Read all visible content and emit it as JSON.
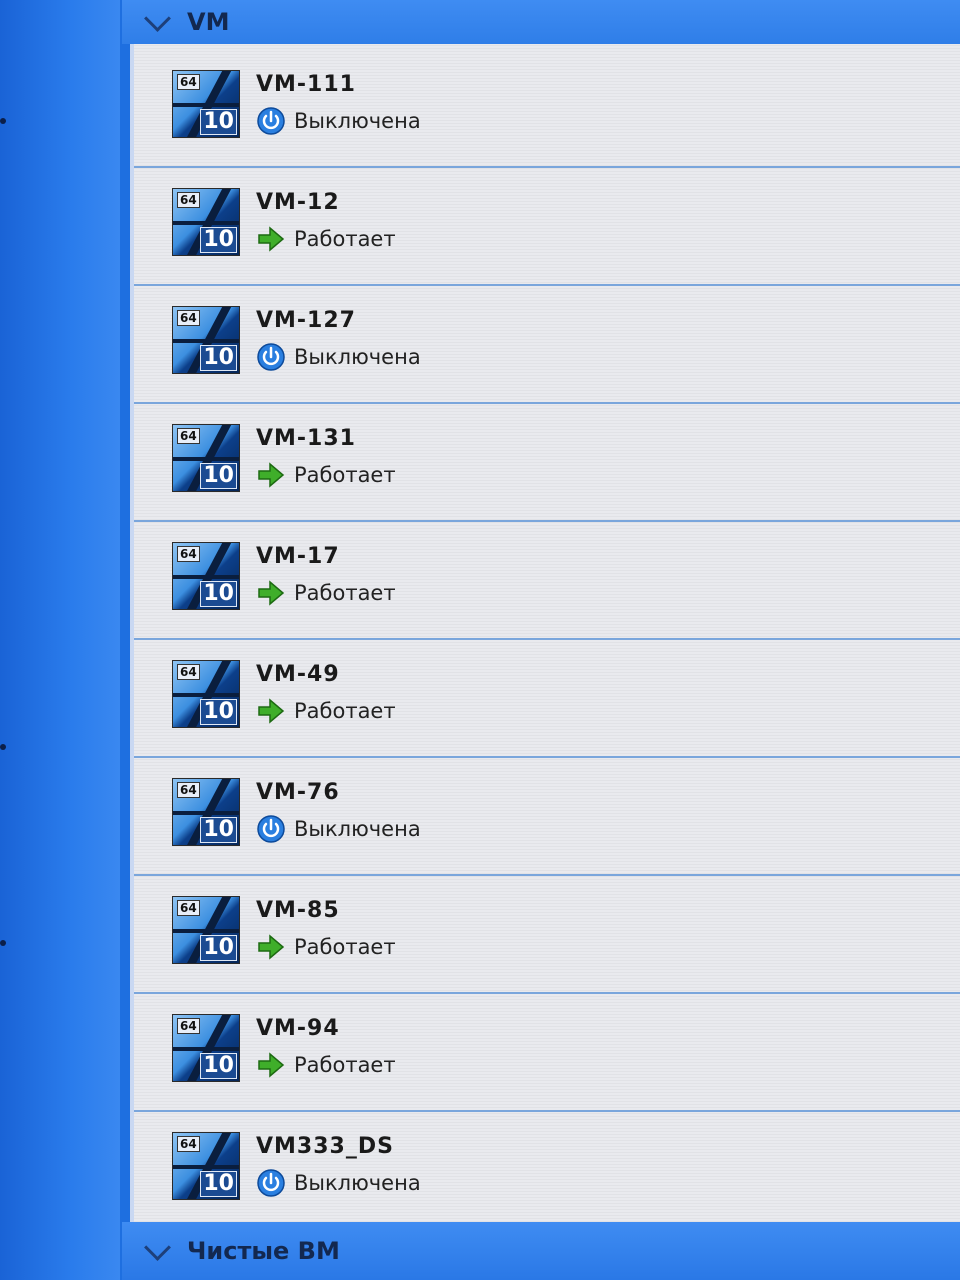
{
  "groups": {
    "top_label": "VM",
    "bottom_label": "Чистые ВМ"
  },
  "icon": {
    "bits_label": "64",
    "version_label": "10"
  },
  "vms": [
    {
      "name": "VM-111",
      "status": "Выключена",
      "state": "off"
    },
    {
      "name": "VM-12",
      "status": "Работает",
      "state": "running"
    },
    {
      "name": "VM-127",
      "status": "Выключена",
      "state": "off"
    },
    {
      "name": "VM-131",
      "status": "Работает",
      "state": "running"
    },
    {
      "name": "VM-17",
      "status": "Работает",
      "state": "running"
    },
    {
      "name": "VM-49",
      "status": "Работает",
      "state": "running"
    },
    {
      "name": "VM-76",
      "status": "Выключена",
      "state": "off"
    },
    {
      "name": "VM-85",
      "status": "Работает",
      "state": "running"
    },
    {
      "name": "VM-94",
      "status": "Работает",
      "state": "running"
    },
    {
      "name": "VM333_DS",
      "status": "Выключена",
      "state": "off"
    }
  ],
  "colors": {
    "running": "#3fae2a",
    "off": "#2a7fe0"
  }
}
